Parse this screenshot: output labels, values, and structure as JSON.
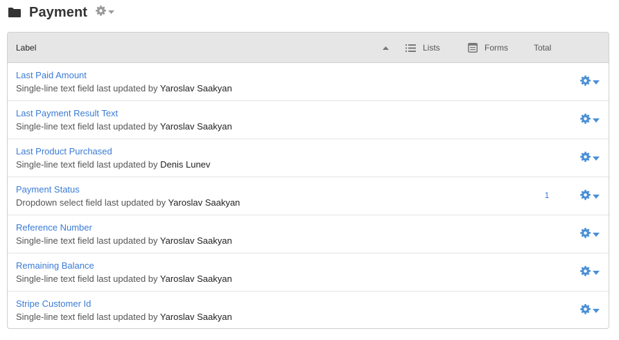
{
  "header": {
    "title": "Payment",
    "folder_icon": "folder-icon",
    "settings_icon": "gear-icon"
  },
  "table": {
    "columns": {
      "label": "Label",
      "lists": "Lists",
      "forms": "Forms",
      "total": "Total"
    },
    "sort": "ascending",
    "rows": [
      {
        "title": "Last Paid Amount",
        "desc": "Single-line text field last updated by",
        "user": "Yaroslav Saakyan",
        "total": ""
      },
      {
        "title": "Last Payment Result Text",
        "desc": "Single-line text field last updated by",
        "user": "Yaroslav Saakyan",
        "total": ""
      },
      {
        "title": "Last Product Purchased",
        "desc": "Single-line text field last updated by",
        "user": "Denis Lunev",
        "total": ""
      },
      {
        "title": "Payment Status",
        "desc": "Dropdown select field last updated by",
        "user": "Yaroslav Saakyan",
        "total": "1"
      },
      {
        "title": "Reference Number",
        "desc": "Single-line text field last updated by",
        "user": "Yaroslav Saakyan",
        "total": ""
      },
      {
        "title": "Remaining Balance",
        "desc": "Single-line text field last updated by",
        "user": "Yaroslav Saakyan",
        "total": ""
      },
      {
        "title": "Stripe Customer Id",
        "desc": "Single-line text field last updated by",
        "user": "Yaroslav Saakyan",
        "total": ""
      }
    ]
  },
  "colors": {
    "link": "#3a7bd5",
    "header_bg": "#e6e6e6",
    "gear_blue": "#4a8fd6",
    "gear_grey": "#9a9a9a"
  }
}
